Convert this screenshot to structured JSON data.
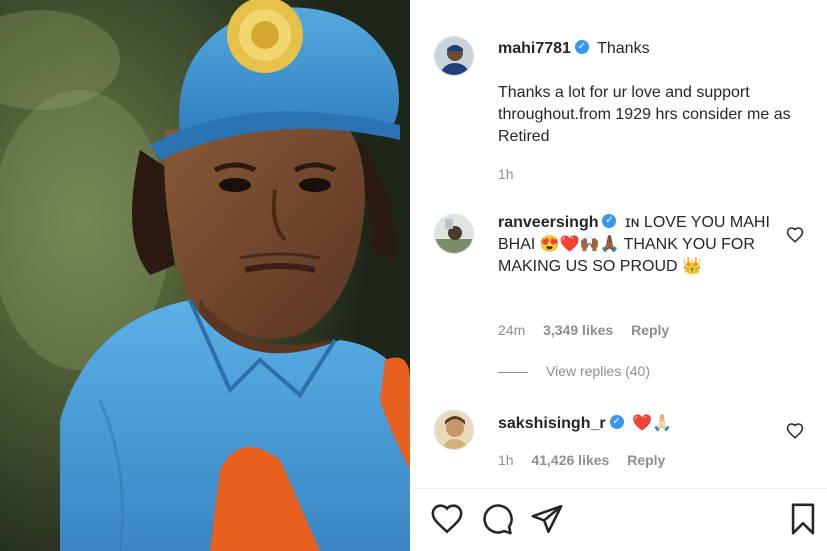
{
  "post": {
    "username": "mahi7781",
    "headline": "Thanks",
    "caption": "Thanks a lot for ur love and support throughout.from 1929 hrs consider me as Retired",
    "time": "1h"
  },
  "comments": [
    {
      "username": "ranveersingh",
      "text": "ɪɴ LOVE YOU MAHI BHAI 😍❤️🙌🏾🙏🏾 THANK YOU FOR MAKING US SO PROUD 👑",
      "time": "24m",
      "likes": "3,349 likes",
      "reply_label": "Reply",
      "view_replies": "View replies (40)"
    },
    {
      "username": "sakshisingh_r",
      "text": "❤️🙏🏻",
      "time": "1h",
      "likes": "41,426 likes",
      "reply_label": "Reply"
    }
  ],
  "icons": {
    "verified": "verified-badge-icon",
    "like": "heart-icon",
    "comment": "comment-bubble-icon",
    "share": "paper-plane-icon",
    "save": "bookmark-icon"
  },
  "colors": {
    "verified_blue": "#3897f0",
    "text": "#262626",
    "muted": "#8e8e8e",
    "jersey_blue": "#4a9fd8"
  }
}
